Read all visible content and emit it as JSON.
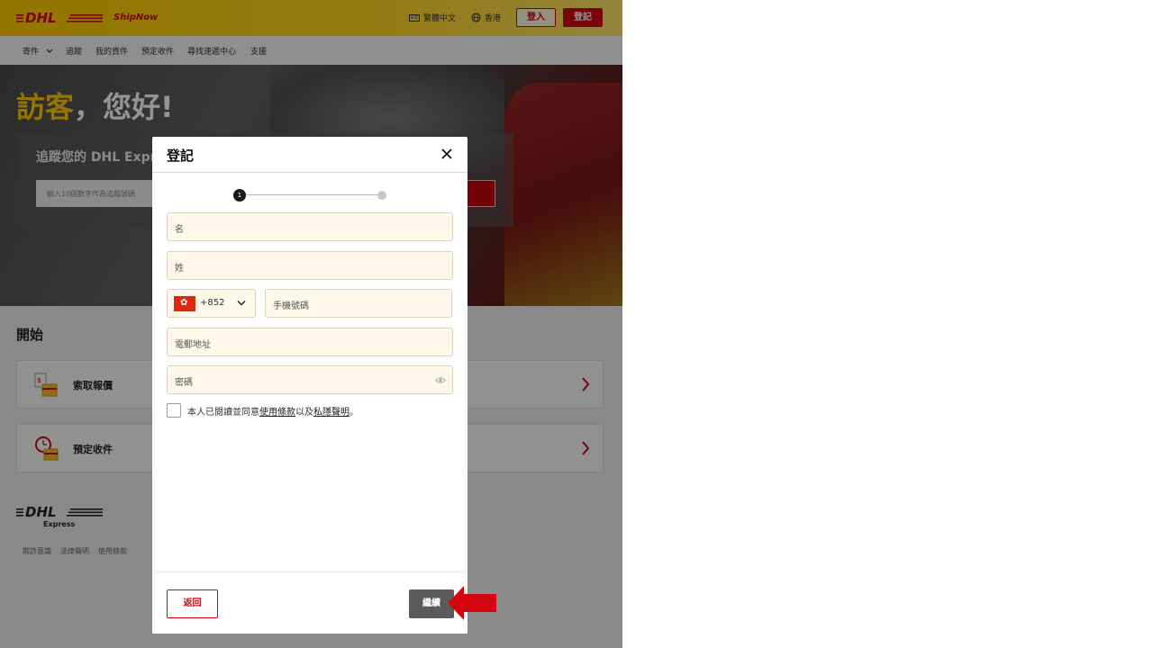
{
  "header": {
    "brand": "DHL",
    "product": "ShipNow",
    "language": "繁體中文",
    "language_icon": "translate-icon",
    "region": "香港",
    "region_icon": "globe-icon",
    "login_label": "登入",
    "register_label": "登記"
  },
  "nav": {
    "items": [
      "寄件",
      "追蹤",
      "我的貨件",
      "預定收件",
      "尋找速遞中心",
      "支援"
    ],
    "dropdown_icon": "chevron-down-icon"
  },
  "hero": {
    "greeting_guest": "訪客",
    "greeting_rest": "，您好!",
    "track_title": "追蹤您的 DHL Expr",
    "track_placeholder": "輸入10個數字作為追蹤號碼"
  },
  "start": {
    "title": "開始",
    "cards": [
      {
        "label": "索取報價",
        "icon": "quote-package-icon"
      },
      {
        "label": "預定收件",
        "icon": "pickup-clock-icon"
      }
    ]
  },
  "footer": {
    "brand": "DHL",
    "brand_sub": "Express",
    "links": [
      "欺詐意識",
      "法律聲明",
      "使用條款"
    ]
  },
  "modal": {
    "title": "登記",
    "steps": {
      "current": "1"
    },
    "first_name_placeholder": "名",
    "last_name_placeholder": "姓",
    "dial_code": "+852",
    "phone_placeholder": "手機號碼",
    "email_placeholder": "電郵地址",
    "password_placeholder": "密碼",
    "agree_prefix": "本人已閱讀並同意",
    "terms_link": "使用條款",
    "agree_middle": "以及",
    "privacy_link": "私隱聲明",
    "agree_suffix": "。",
    "back_label": "返回",
    "continue_label": "繼續"
  },
  "colors": {
    "dhl_yellow": "#ffcc00",
    "dhl_red": "#d40511",
    "field_bg": "#fdf8e8",
    "continue_bg": "#5b5b5b"
  }
}
